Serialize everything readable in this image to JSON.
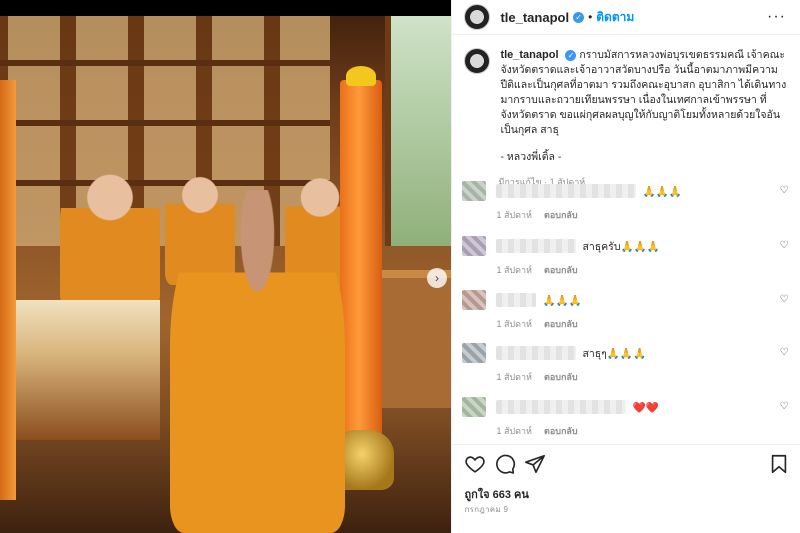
{
  "post": {
    "username": "tle_tanapol",
    "verified_mark": "✓",
    "separator": "•",
    "follow_label": "ติดตาม",
    "more_label": "···",
    "caption_username": "tle_tanapol",
    "caption_body": "กราบมัสการหลวงพ่อบุรเขตธรรมคณี เจ้าคณะจังหวัดตราดและเจ้าอาวาสวัดบางปรือ วันนี้อาตมาภาพมีความปีติและเป็นกุศลที่อาตมา รวมถึงคณะอุบาสก อุบาสิกา ได้เดินทางมากราบและถวายเทียนพรรษา เนื่องในเทศกาลเข้าพรรษา ที่จังหวัดตราด ขอแผ่กุศลผลบุญให้กับญาติโยมทั้งหลายด้วยใจอันเป็นกุศล สาธุ",
    "caption_signature": "- หลวงพี่เติ้ล -",
    "caption_meta": "มีการแก้ไข · 1 สัปดาห์",
    "likes_text": "ถูกใจ 663 คน",
    "date_text": "กรกฎาคม 9"
  },
  "comments": [
    {
      "text": "🙏🙏🙏",
      "time": "1 สัปดาห์",
      "reply": "ตอบกลับ"
    },
    {
      "text": "สาธุครับ🙏🙏🙏",
      "time": "1 สัปดาห์",
      "reply": "ตอบกลับ"
    },
    {
      "text": "🙏🙏🙏",
      "time": "1 สัปดาห์",
      "reply": "ตอบกลับ"
    },
    {
      "text": "สาธุๆ🙏🙏🙏",
      "time": "1 สัปดาห์",
      "reply": "ตอบกลับ"
    },
    {
      "text": "❤️❤️",
      "time": "1 สัปดาห์",
      "reply": "ตอบกลับ"
    }
  ],
  "icons": {
    "next": "›",
    "heart_small": "♡",
    "bookmark": "bookmark-icon"
  },
  "colors": {
    "accent": "#0095f6",
    "verified": "#3897f0",
    "muted": "#8e8e8e"
  }
}
